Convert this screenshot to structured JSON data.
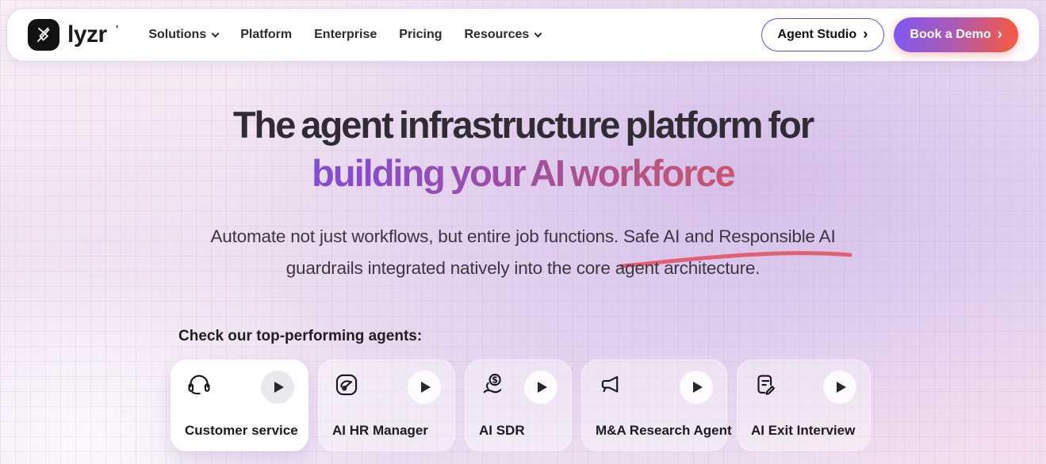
{
  "header": {
    "brand": {
      "name": "lyzr",
      "tick": "’"
    },
    "nav": [
      {
        "label": "Solutions",
        "has_dropdown": true
      },
      {
        "label": "Platform",
        "has_dropdown": false
      },
      {
        "label": "Enterprise",
        "has_dropdown": false
      },
      {
        "label": "Pricing",
        "has_dropdown": false
      },
      {
        "label": "Resources",
        "has_dropdown": true
      }
    ],
    "actions": {
      "agent_studio": {
        "label": "Agent Studio",
        "chevron": "›"
      },
      "book_demo": {
        "label": "Book a Demo",
        "chevron": "›"
      }
    }
  },
  "hero": {
    "title_line1": "The agent infrastructure platform for",
    "title_line2": "building your AI workforce",
    "subtitle_line1": "Automate not just workflows, but entire job functions. Safe AI and Responsible AI",
    "subtitle_line2": "guardrails integrated natively into the core agent architecture.",
    "underline_annotation": "hand-drawn swoosh under “Safe AI and Responsible AI”"
  },
  "agents": {
    "label": "Check our top-performing agents:",
    "items": [
      {
        "label": "Customer service",
        "icon": "headset-icon",
        "highlighted": true
      },
      {
        "label": "AI HR Manager",
        "icon": "gauge-icon",
        "highlighted": false
      },
      {
        "label": "AI SDR",
        "icon": "hand-dollar-icon",
        "highlighted": false
      },
      {
        "label": "M&A Research Agent",
        "icon": "megaphone-icon",
        "highlighted": false
      },
      {
        "label": "AI Exit Interview",
        "icon": "document-edit-icon",
        "highlighted": false
      }
    ]
  },
  "colors": {
    "title_text": "#2f2c34",
    "title_gradient": [
      "#5746f1",
      "#a04fa0",
      "#fa6c3b"
    ],
    "demo_button_gradient": [
      "#7e57f2",
      "#ef5a4a"
    ],
    "agent_studio_border": "#5b4cf0",
    "underline_swoosh": "#e16073",
    "background_base": "#ecdff1",
    "navbar_background": "#ffffff"
  }
}
